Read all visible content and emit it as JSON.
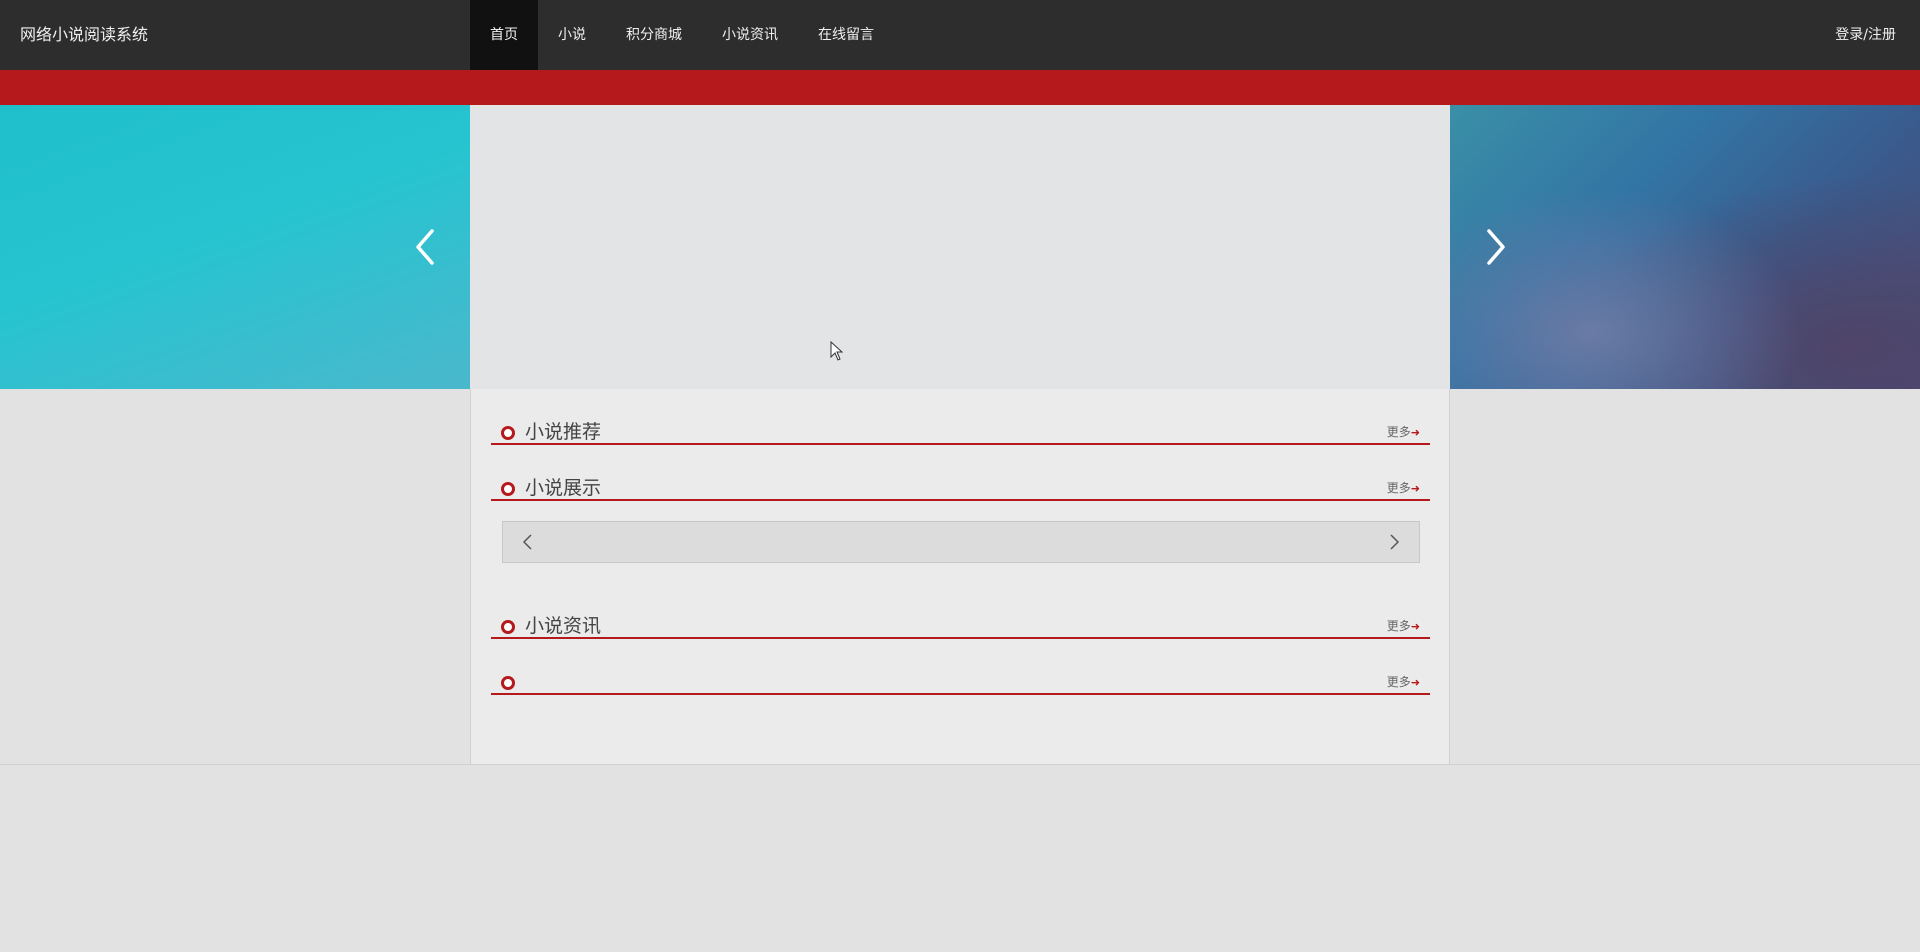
{
  "header": {
    "brand": "网络小说阅读系统",
    "nav": [
      {
        "label": "首页",
        "active": true
      },
      {
        "label": "小说",
        "active": false
      },
      {
        "label": "积分商城",
        "active": false
      },
      {
        "label": "小说资讯",
        "active": false
      },
      {
        "label": "在线留言",
        "active": false
      }
    ],
    "login_label": "登录/注册"
  },
  "banner": {
    "prev_icon": "chevron-left-icon",
    "next_icon": "chevron-right-icon"
  },
  "sections": [
    {
      "title": "小说推荐",
      "more": "更多"
    },
    {
      "title": "小说展示",
      "more": "更多"
    },
    {
      "title": "小说资讯",
      "more": "更多"
    },
    {
      "title": "",
      "more": "更多"
    }
  ],
  "colors": {
    "accent": "#b5191b",
    "navbar": "#2d2d2d",
    "nav_active": "#111111"
  }
}
